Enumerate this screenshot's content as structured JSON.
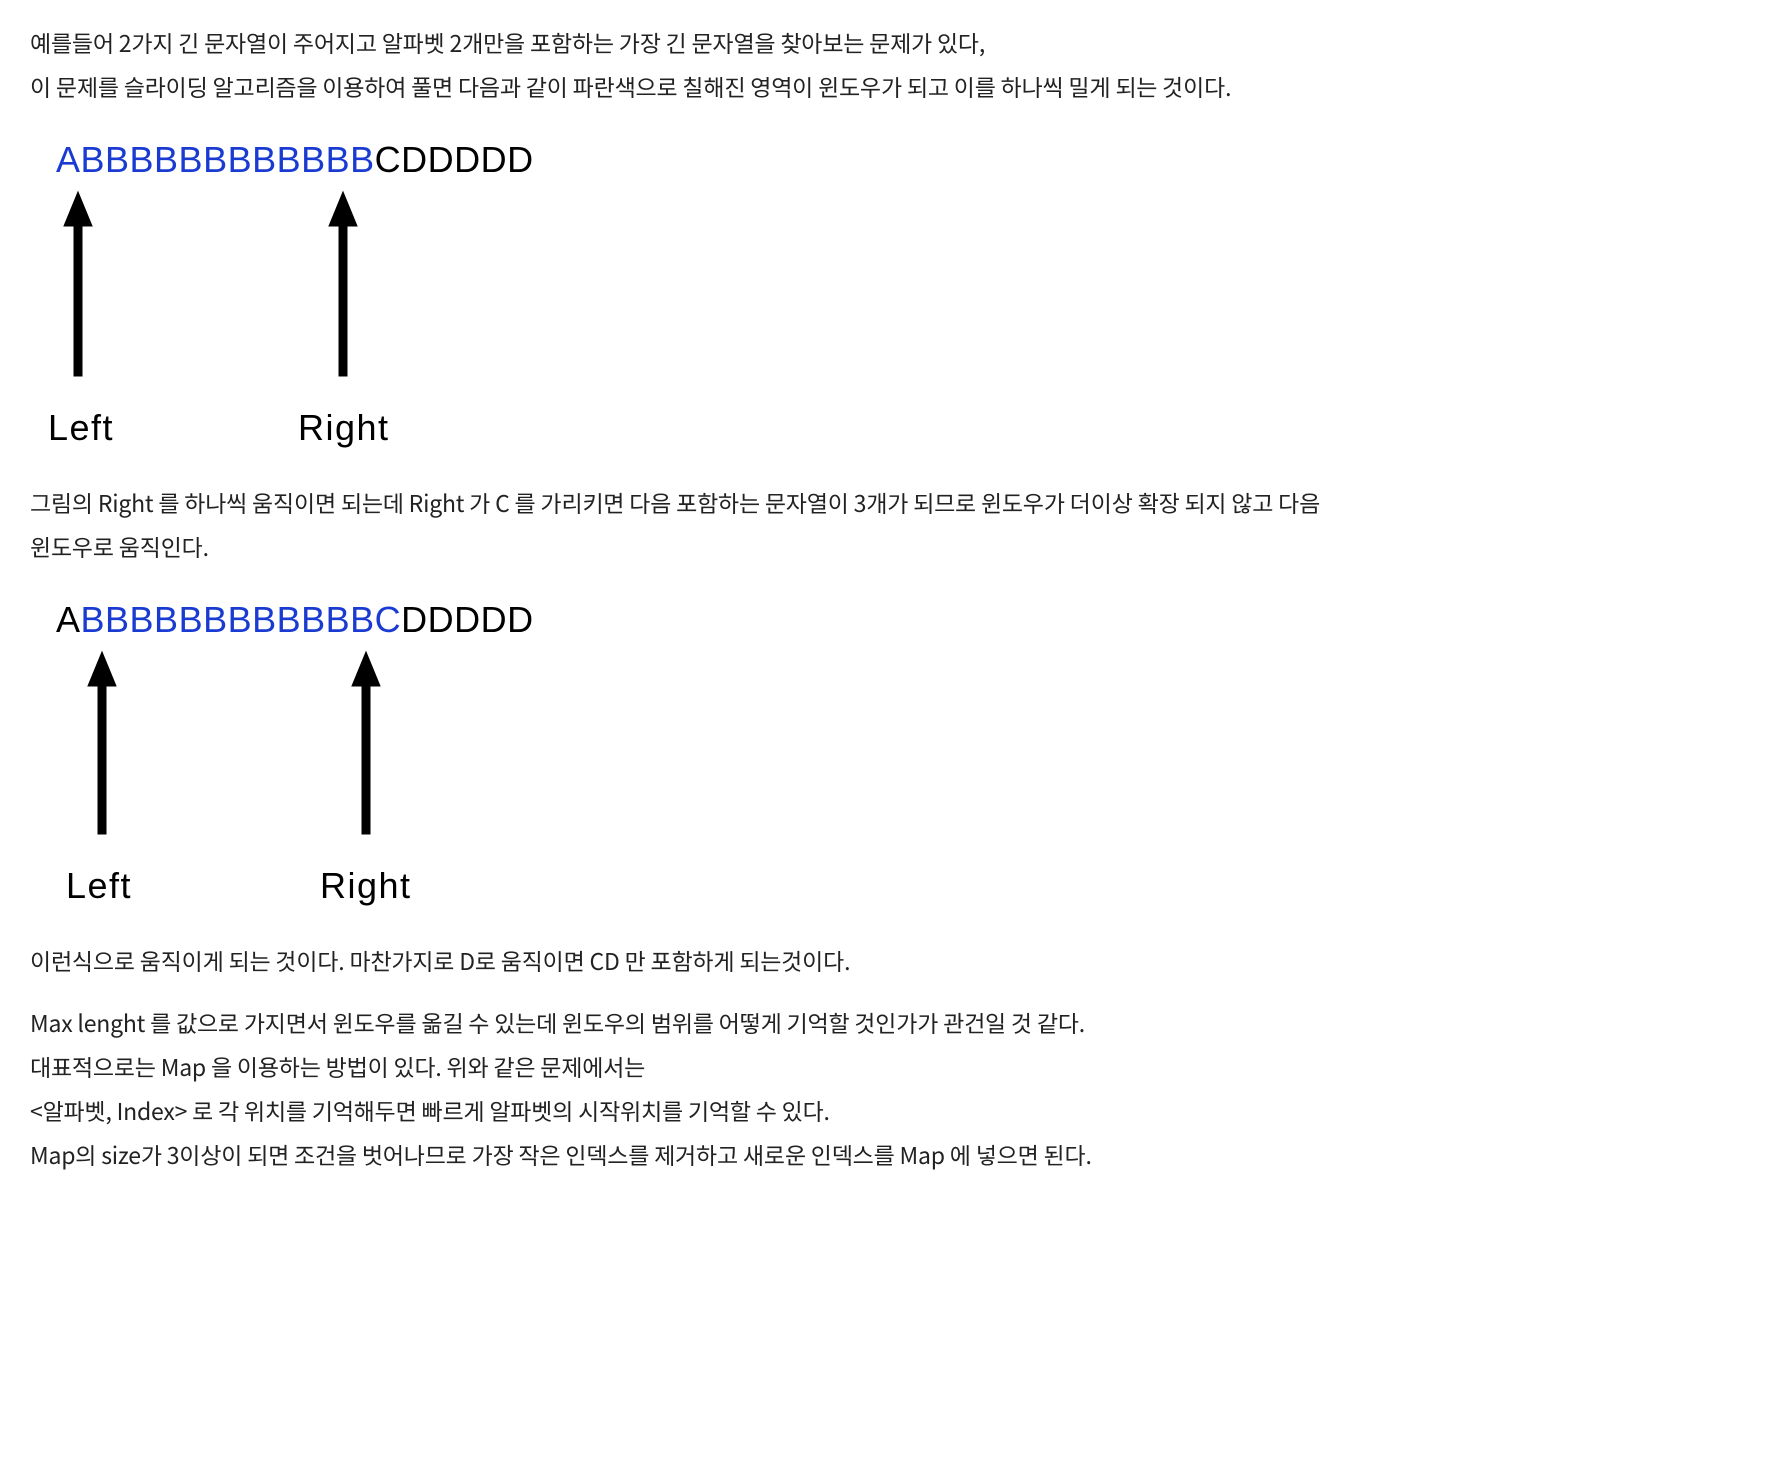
{
  "paragraphs": {
    "p1": "예를들어 2가지 긴 문자열이 주어지고 알파벳 2개만을 포함하는 가장 긴 문자열을 찾아보는 문제가 있다,",
    "p2": "이 문제를 슬라이딩 알고리즘을 이용하여 풀면 다음과 같이 파란색으로 칠해진 영역이 윈도우가 되고 이를 하나씩 밀게 되는 것이다.",
    "p3a": "그림의 Right 를 하나씩 움직이면 되는데 Right 가 C 를 가리키면 다음 포함하는 문자열이 3개가 되므로 윈도우가 더이상 확장 되지 않고 다음",
    "p3b": "윈도우로 움직인다.",
    "p4": "이런식으로 움직이게 되는 것이다. 마찬가지로 D로 움직이면 CD 만 포함하게 되는것이다.",
    "p5a": "Max lenght 를 값으로 가지면서 윈도우를 옮길 수 있는데 윈도우의 범위를 어떻게 기억할 것인가가 관건일 것 같다.",
    "p5b": "대표적으로는 Map 을 이용하는 방법이 있다. 위와 같은 문제에서는",
    "p5c": "<알파벳, Index> 로 각 위치를 기억해두면 빠르게 알파벳의 시작위치를 기억할 수 있다.",
    "p5d": "Map의 size가 3이상이 되면 조건을 벗어나므로 가장 작은 인덱스를 제거하고 새로운 인덱스를 Map 에 넣으면 된다."
  },
  "diagram1": {
    "seg_highlight": "ABBBBBBBBBBBB",
    "seg_plain": "CDDDDD",
    "left_label": "Left",
    "right_label": "Right"
  },
  "diagram2": {
    "seg_a": "A",
    "seg_highlight": "BBBBBBBBBBBBC",
    "seg_plain": "DDDDD",
    "left_label": "Left",
    "right_label": "Right"
  }
}
